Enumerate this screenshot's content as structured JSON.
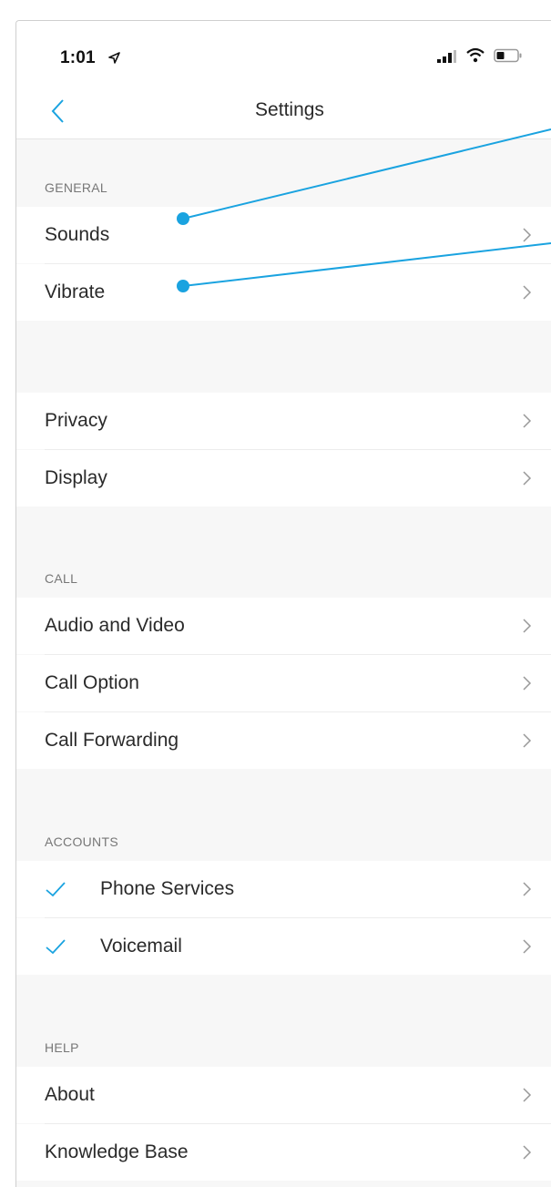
{
  "status": {
    "time": "1:01"
  },
  "nav": {
    "title": "Settings"
  },
  "sections": {
    "general": "GENERAL",
    "call": "CALL",
    "accounts": "ACCOUNTS",
    "help": "HELP"
  },
  "rows": {
    "sounds": "Sounds",
    "vibrate": "Vibrate",
    "privacy": "Privacy",
    "display": "Display",
    "audio_video": "Audio and Video",
    "call_option": "Call Option",
    "call_forwarding": "Call Forwarding",
    "phone_services": "Phone Services",
    "voicemail": "Voicemail",
    "about": "About",
    "knowledge_base": "Knowledge Base"
  },
  "colors": {
    "accent": "#1aa3e0",
    "annotation": "#1aa3e0"
  },
  "icons": {
    "back": "chevron-left-icon",
    "row": "chevron-right-icon",
    "check": "checkmark-icon"
  }
}
